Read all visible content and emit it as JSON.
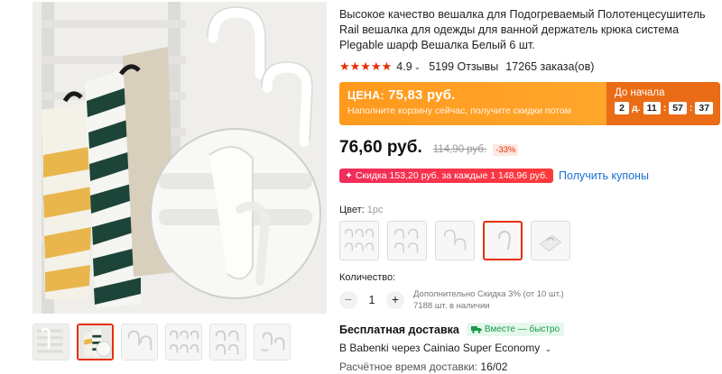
{
  "product": {
    "title": "Высокое качество вешалка для Подогреваемый Полотенцесушитель Rail вешалка для одежды для ванной держатель крюка система Plegable шарф Вешалка Белый 6 шт.",
    "rating": "4.9",
    "stars": "★★★★★",
    "reviews": "5199 Отзывы",
    "orders": "17265 заказа(ов)"
  },
  "sale": {
    "price_label": "ЦЕНА:",
    "price": "75,83 руб.",
    "subtitle": "Наполните корзину сейчас, получите скидки потом",
    "countdown_label": "До начала",
    "days": "2",
    "days_unit": "д.",
    "hours": "11",
    "minutes": "57",
    "seconds": "37"
  },
  "price": {
    "current": "76,60 руб.",
    "old": "114,90 руб.",
    "discount": "-33%"
  },
  "coupon": {
    "text": "Скидка 153,20 руб. за каждые 1 148,96 руб.",
    "icon": "✦",
    "link": "Получить купоны"
  },
  "color": {
    "label": "Цвет:",
    "value": "1pc",
    "selected_index": 3
  },
  "quantity": {
    "label": "Количество:",
    "value": "1",
    "minus": "−",
    "plus": "+",
    "bulk_discount": "Дополнительно Скидка 3% (от 10 шт.)",
    "stock": "7188 шт. в наличии"
  },
  "shipping": {
    "title": "Бесплатная доставка",
    "badge": "Вместе — быстро",
    "via": "В Babenki через Cainiao Super Economy",
    "time_label": "Расчётное время доставки:",
    "date": "16/02"
  },
  "colors": {
    "accent": "#e62e04",
    "sale_orange": "#ff9a1e",
    "link_blue": "#1a6fd4",
    "green": "#1a9b4b"
  }
}
